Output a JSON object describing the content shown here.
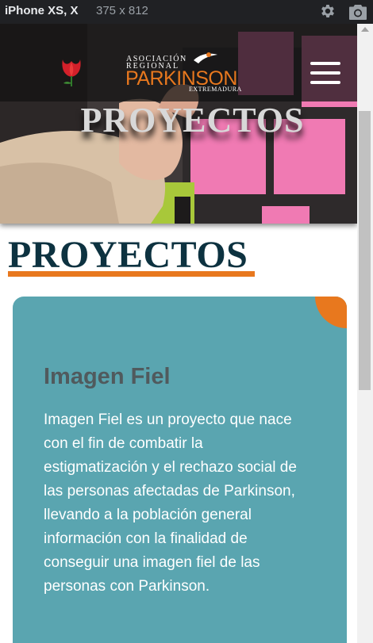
{
  "devtools": {
    "device_name": "iPhone XS, X",
    "dimensions": "375 x 812",
    "icons": [
      "gear-icon",
      "camera-icon"
    ]
  },
  "header": {
    "logo": {
      "line1": "ASOCIACIÓN",
      "line2": "REGIONAL",
      "main": "PARKINSON",
      "line3": "EXTREMADURA"
    },
    "icons": [
      "tulip-logo-icon",
      "hamburger-menu-icon"
    ]
  },
  "hero": {
    "title": "PROYECTOS"
  },
  "main": {
    "heading": "PROYECTOS",
    "card": {
      "title": "Imagen Fiel",
      "body": "Imagen Fiel es un proyecto que nace con el fin de combatir la estigmatización y el rechazo social de las personas afectadas de Parkinson, llevando a la población general información con la finalidad de conseguir una imagen fiel de las personas con Parkinson."
    }
  },
  "colors": {
    "accent_orange": "#e8781e",
    "card_teal": "#5aa5b0",
    "heading_navy": "#0d3240",
    "devtools_bg": "#202124"
  }
}
